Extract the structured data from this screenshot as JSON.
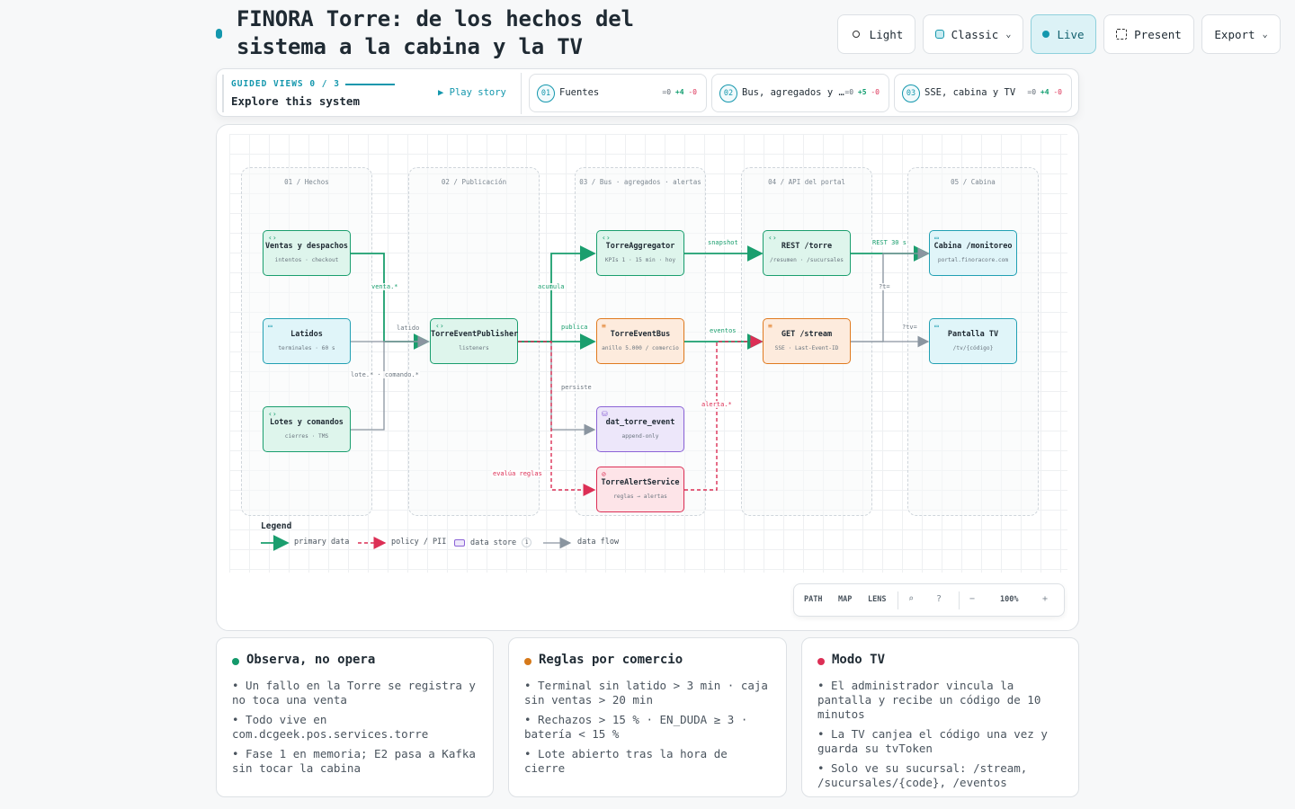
{
  "header": {
    "title": "FINORA Torre: de los hechos del sistema a la cabina y la TV",
    "buttons": {
      "light": "Light",
      "classic": "Classic",
      "live": "Live",
      "present": "Present",
      "export": "Export"
    }
  },
  "guided": {
    "label": "GUIDED VIEWS 0 / 3",
    "title": "Explore this system",
    "play": "Play story",
    "steps": [
      {
        "num": "01",
        "label": "Fuentes",
        "eq": "=0",
        "plus": "+4",
        "minus": "-0"
      },
      {
        "num": "02",
        "label": "Bus, agregados y alertas",
        "eq": "=0",
        "plus": "+5",
        "minus": "-0"
      },
      {
        "num": "03",
        "label": "SSE, cabina y TV",
        "eq": "=0",
        "plus": "+4",
        "minus": "-0"
      }
    ]
  },
  "diagram": {
    "lanes": [
      "01 / Hechos",
      "02 / Publicación",
      "03 / Bus · agregados · alertas",
      "04 / API del portal",
      "05 / Cabina"
    ],
    "nodes": {
      "ventas": {
        "title": "Ventas y despachos",
        "sub": "intentos · checkout"
      },
      "latidos": {
        "title": "Latidos",
        "sub": "terminales · 60 s"
      },
      "lotes": {
        "title": "Lotes y comandos",
        "sub": "cierres · TMS"
      },
      "publisher": {
        "title": "TorreEventPublisher",
        "sub": "listeners"
      },
      "aggregator": {
        "title": "TorreAggregator",
        "sub": "KPIs 1 · 15 min · hoy"
      },
      "bus": {
        "title": "TorreEventBus",
        "sub": "anillo 5.000 / comercio"
      },
      "store": {
        "title": "dat_torre_event",
        "sub": "append-only"
      },
      "alert": {
        "title": "TorreAlertService",
        "sub": "reglas → alertas"
      },
      "rest": {
        "title": "REST /torre",
        "sub": "/resumen · /sucursales"
      },
      "stream": {
        "title": "GET /stream",
        "sub": "SSE · Last-Event-ID"
      },
      "cabina": {
        "title": "Cabina /monitoreo",
        "sub": "portal.finoracore.com"
      },
      "tv": {
        "title": "Pantalla TV",
        "sub": "/tv/{código}"
      }
    },
    "edge_labels": {
      "venta": "venta.*",
      "latido": "latido",
      "lote": "lote.* · comando.*",
      "acumula": "acumula",
      "publica": "publica",
      "persiste": "persiste",
      "evalua": "evalúa reglas",
      "snapshot": "snapshot",
      "eventos": "eventos",
      "alerta": "alerta.*",
      "rest30": "REST 30 s",
      "t": "?t=",
      "tv": "?tv="
    },
    "legend": {
      "title": "Legend",
      "primary": "primary data",
      "policy": "policy / PII",
      "store": "data store",
      "store_count": "1",
      "flow": "data flow"
    },
    "zoom": {
      "path": "PATH",
      "map": "MAP",
      "lens": "LENS",
      "level": "100%",
      "minus": "−",
      "plus": "+"
    },
    "colors": {
      "green": "#1a9e6e",
      "gray": "#8a95a0",
      "red": "#dc2f55"
    }
  },
  "cards": [
    {
      "title": "Observa, no opera",
      "color": "#14996b",
      "items": [
        "• Un fallo en la Torre se registra y no toca una venta",
        "• Todo vive en com.dcgeek.pos.services.torre",
        "• Fase 1 en memoria; E2 pasa a Kafka sin tocar la cabina"
      ]
    },
    {
      "title": "Reglas por comercio",
      "color": "#d6791a",
      "items": [
        "• Terminal sin latido > 3 min · caja sin ventas > 20 min",
        "• Rechazos > 15 % · EN_DUDA ≥ 3 · batería < 15 %",
        "• Lote abierto tras la hora de cierre"
      ]
    },
    {
      "title": "Modo TV",
      "color": "#dc2f55",
      "items": [
        "• El administrador vincula la pantalla y recibe un código de 10 minutos",
        "• La TV canjea el código una vez y guarda su tvToken",
        "• Solo ve su sucursal: /stream, /sucursales/{code}, /eventos"
      ]
    }
  ]
}
